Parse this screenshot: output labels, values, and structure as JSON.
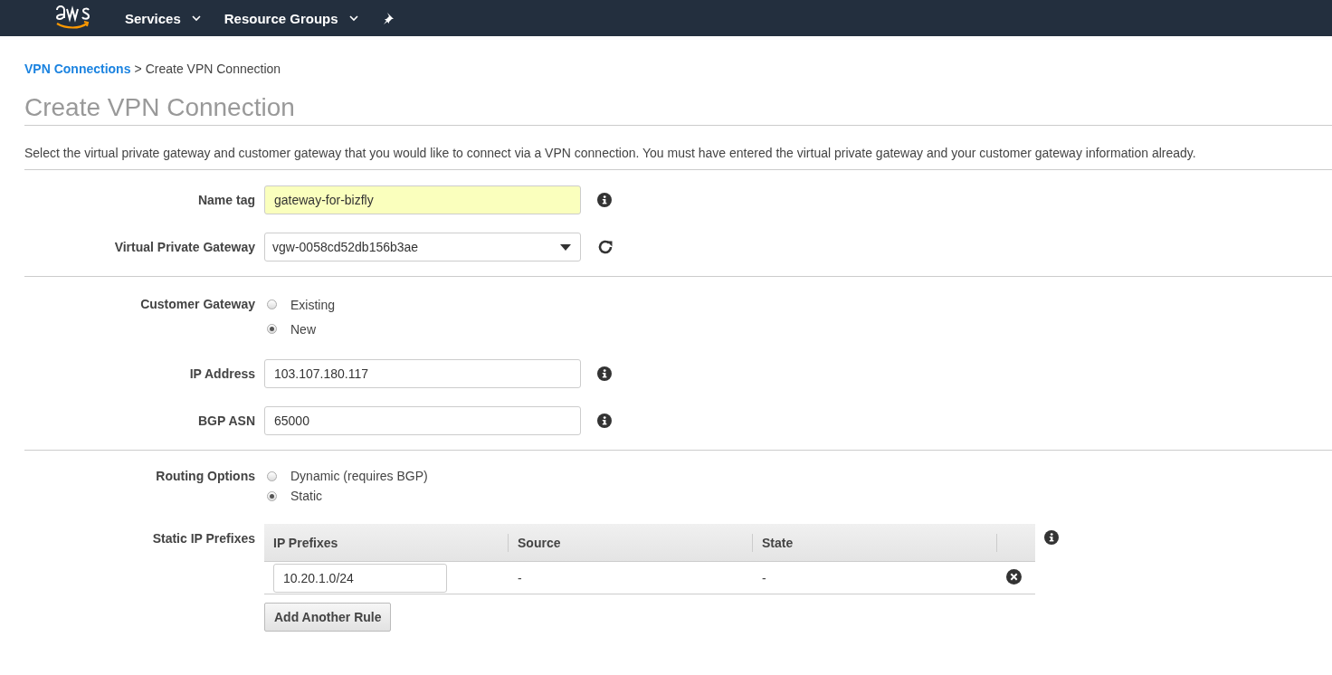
{
  "nav": {
    "menus": [
      {
        "label": "Services"
      },
      {
        "label": "Resource Groups"
      }
    ]
  },
  "breadcrumb": {
    "link": "VPN Connections",
    "separator": ">",
    "current": "Create VPN Connection"
  },
  "title": "Create VPN Connection",
  "description": "Select the virtual private gateway and customer gateway that you would like to connect via a VPN connection. You must have entered the virtual private gateway and your customer gateway information already.",
  "sections": [
    {
      "fields": [
        {
          "kind": "text",
          "label": "Name tag",
          "value": "gateway-for-bizfly",
          "highlighted": true,
          "action": {
            "kind": "info"
          }
        },
        {
          "kind": "select",
          "label": "Virtual Private Gateway",
          "value": "vgw-0058cd52db156b3ae",
          "action": {
            "kind": "refresh"
          }
        }
      ]
    },
    {
      "fields": [
        {
          "kind": "radio",
          "label": "Customer Gateway",
          "options": [
            {
              "label": "Existing",
              "selected": false
            },
            {
              "label": "New",
              "selected": true
            }
          ]
        },
        {
          "kind": "text",
          "label": "IP Address",
          "value": "103.107.180.117",
          "highlighted": false,
          "action": {
            "kind": "info"
          }
        },
        {
          "kind": "text",
          "label": "BGP ASN",
          "value": "65000",
          "highlighted": false,
          "action": {
            "kind": "info"
          }
        }
      ]
    },
    {
      "fields": [
        {
          "kind": "radio",
          "label": "Routing Options",
          "options": [
            {
              "label": "Dynamic (requires BGP)",
              "selected": false
            },
            {
              "label": "Static",
              "selected": true
            }
          ]
        },
        {
          "kind": "table",
          "label": "Static IP Prefixes",
          "columns": [
            "IP Prefixes",
            "Source",
            "State"
          ],
          "rows": [
            {
              "prefix": "10.20.1.0/24",
              "source": "-",
              "state": "-"
            }
          ],
          "button": "Add Another Rule",
          "action": {
            "kind": "info"
          }
        }
      ]
    }
  ]
}
